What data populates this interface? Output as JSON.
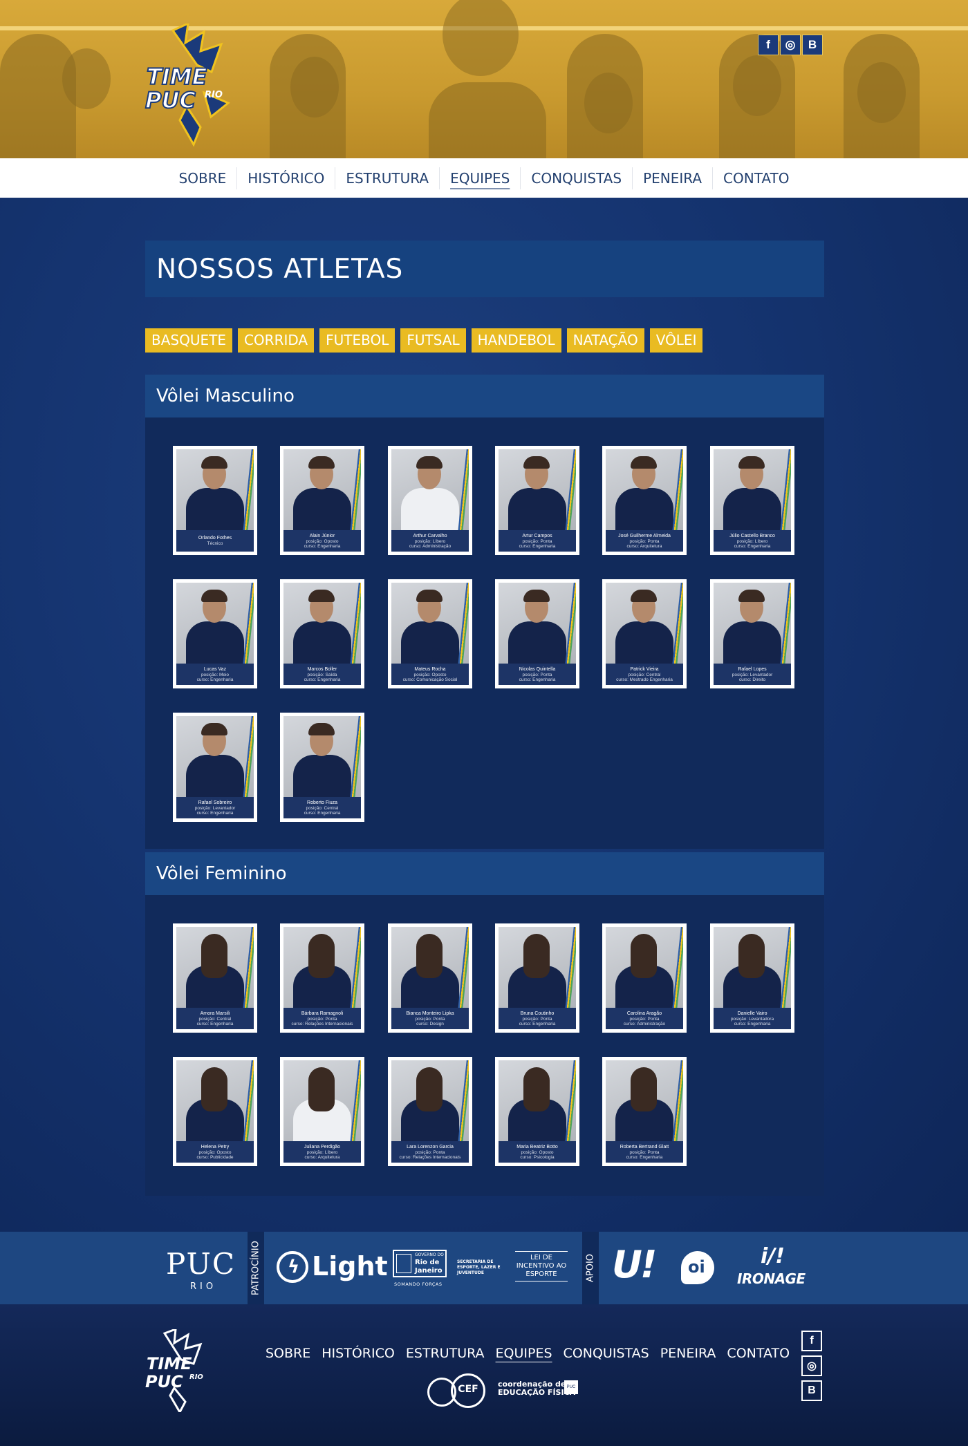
{
  "brand": {
    "logo_line1": "TIME",
    "logo_line2": "PUC",
    "logo_line3": "RIO",
    "colors": {
      "navy": "#0f2a5e",
      "gold": "#e9bb22",
      "header_bar": "#16427f"
    }
  },
  "social": [
    {
      "label": "f",
      "icon": "facebook-icon"
    },
    {
      "label": "◎",
      "icon": "instagram-icon"
    },
    {
      "label": "B",
      "icon": "blogger-icon"
    }
  ],
  "nav": {
    "items": [
      "SOBRE",
      "HISTÓRICO",
      "ESTRUTURA",
      "EQUIPES",
      "CONQUISTAS",
      "PENEIRA",
      "CONTATO"
    ],
    "active": "EQUIPES"
  },
  "page": {
    "title": "NOSSOS ATLETAS"
  },
  "sport_tabs": [
    "BASQUETE",
    "CORRIDA",
    "FUTEBOL",
    "FUTSAL",
    "HANDEBOL",
    "NATAÇÃO",
    "VÔLEI"
  ],
  "sections": [
    {
      "title": "Vôlei Masculino",
      "athletes": [
        {
          "name": "Orlando Fothes",
          "pos": "Técnico",
          "course": ""
        },
        {
          "name": "Alain Júnior",
          "pos": "posição: Oposto",
          "course": "curso: Engenharia"
        },
        {
          "name": "Arthur Carvalho",
          "pos": "posição: Líbero",
          "course": "curso: Administração"
        },
        {
          "name": "Artur Campos",
          "pos": "posição: Ponta",
          "course": "curso: Engenharia"
        },
        {
          "name": "José Guilherme Almeida",
          "pos": "posição: Ponta",
          "course": "curso: Arquitetura"
        },
        {
          "name": "Júlio Castello Branco",
          "pos": "posição: Líbero",
          "course": "curso: Engenharia"
        },
        {
          "name": "Lucas Vaz",
          "pos": "posição: Meio",
          "course": "curso: Engenharia"
        },
        {
          "name": "Marcos Boller",
          "pos": "posição: Saída",
          "course": "curso: Engenharia"
        },
        {
          "name": "Mateus Rocha",
          "pos": "posição: Oposto",
          "course": "curso: Comunicação Social"
        },
        {
          "name": "Nicolas Quintella",
          "pos": "posição: Ponta",
          "course": "curso: Engenharia"
        },
        {
          "name": "Patrick Vieira",
          "pos": "posição: Central",
          "course": "curso: Mestrado Engenharia"
        },
        {
          "name": "Rafael Lopes",
          "pos": "posição: Levantador",
          "course": "curso: Direito"
        },
        {
          "name": "Rafael Sobreiro",
          "pos": "posição: Levantador",
          "course": "curso: Engenharia"
        },
        {
          "name": "Roberto Fiuza",
          "pos": "posição: Central",
          "course": "curso: Engenharia"
        }
      ]
    },
    {
      "title": "Vôlei Feminino",
      "athletes": [
        {
          "name": "Amora Marsili",
          "pos": "posição: Central",
          "course": "curso: Engenharia"
        },
        {
          "name": "Bárbara Ramagnoli",
          "pos": "posição: Ponta",
          "course": "curso: Relações Internacionais"
        },
        {
          "name": "Bianca Monteiro Lipka",
          "pos": "posição: Ponta",
          "course": "curso: Design"
        },
        {
          "name": "Bruna Coutinho",
          "pos": "posição: Ponta",
          "course": "curso: Engenharia"
        },
        {
          "name": "Carolina Aragão",
          "pos": "posição: Ponta",
          "course": "curso: Administração"
        },
        {
          "name": "Danielle Vairo",
          "pos": "posição: Levantadora",
          "course": "curso: Engenharia"
        },
        {
          "name": "Helena Petry",
          "pos": "posição: Oposto",
          "course": "curso: Publicidade"
        },
        {
          "name": "Juliana Perdigão",
          "pos": "posição: Líbero",
          "course": "curso: Arquitetura"
        },
        {
          "name": "Lara Lorenzon Garcia",
          "pos": "posição: Ponta",
          "course": "curso: Relações Internacionais"
        },
        {
          "name": "Maria Beatriz Botto",
          "pos": "posição: Oposto",
          "course": "curso: Psicologia"
        },
        {
          "name": "Roberta Bertrand Glatt",
          "pos": "posição: Ponta",
          "course": "curso: Engenharia"
        }
      ]
    }
  ],
  "sponsors": {
    "patrocinio_label": "PATROCÍNIO",
    "apoio_label": "APOIO",
    "puc_text": "PUC",
    "puc_sub": "RIO",
    "light_text": "Light",
    "gov_lines": [
      "GOVERNO DO",
      "Rio de",
      "Janeiro"
    ],
    "gov_motto": "SOMANDO FORÇAS",
    "secretaria": [
      "SECRETARIA DE",
      "ESPORTE, LAZER E",
      "JUVENTUDE"
    ],
    "lei": [
      "LEI DE",
      "INCENTIVO AO",
      "ESPORTE"
    ],
    "u_text": "U!",
    "oi_text": "oi",
    "ironage_mark": "i/!",
    "ironage_text": "IRONAGE"
  },
  "footer": {
    "nav": [
      "SOBRE",
      "HISTÓRICO",
      "ESTRUTURA",
      "EQUIPES",
      "CONQUISTAS",
      "PENEIRA",
      "CONTATO"
    ],
    "active": "EQUIPES",
    "cef_mark": "CEF",
    "cef_text_1": "coordenação de",
    "cef_text_2": "EDUCAÇÃO FÍSICA",
    "cef_tag": "PUC"
  }
}
